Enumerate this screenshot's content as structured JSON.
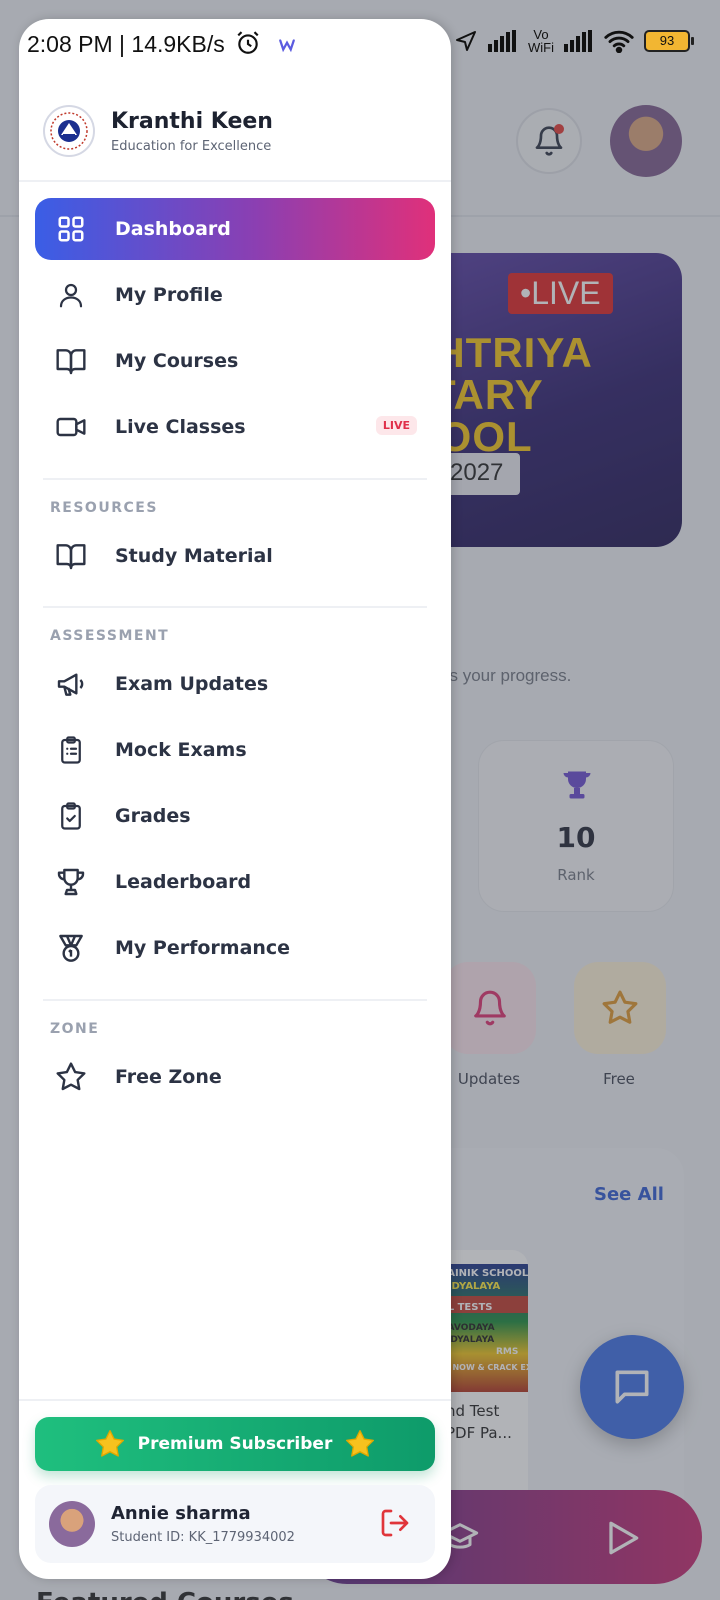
{
  "status_bar": {
    "time": "2:08 PM | 14.9KB/s",
    "vowifi_top": "Vo",
    "vowifi_bottom": "WiFi",
    "battery": "93"
  },
  "drawer": {
    "brand": {
      "name": "Kranthi Keen",
      "tagline": "Education for Excellence"
    },
    "main_items": [
      {
        "label": "Dashboard",
        "icon": "grid-icon",
        "active": true
      },
      {
        "label": "My Profile",
        "icon": "user-icon"
      },
      {
        "label": "My Courses",
        "icon": "book-open-icon"
      },
      {
        "label": "Live Classes",
        "icon": "video-icon",
        "badge": "LIVE"
      }
    ],
    "sections": [
      {
        "title": "RESOURCES",
        "items": [
          {
            "label": "Study Material",
            "icon": "book-open-icon"
          }
        ]
      },
      {
        "title": "ASSESSMENT",
        "items": [
          {
            "label": "Exam Updates",
            "icon": "megaphone-icon"
          },
          {
            "label": "Mock Exams",
            "icon": "clipboard-list-icon"
          },
          {
            "label": "Grades",
            "icon": "clipboard-check-icon"
          },
          {
            "label": "Leaderboard",
            "icon": "trophy-icon"
          },
          {
            "label": "My Performance",
            "icon": "medal-icon"
          }
        ]
      },
      {
        "title": "ZONE",
        "items": [
          {
            "label": "Free Zone",
            "icon": "star-icon"
          }
        ]
      }
    ],
    "premium_label": "Premium Subscriber",
    "user": {
      "name": "Annie sharma",
      "student_id": "Student ID: KK_1779934002"
    }
  },
  "background": {
    "banner": {
      "live": "•LIVE",
      "line1": "ASHTRIYA",
      "line2": "ILITARY",
      "line3": "CHOOL",
      "year": "2027"
    },
    "progress_text": "’s your progress.",
    "rank": {
      "value": "10",
      "label": "Rank"
    },
    "quick_links": [
      {
        "label": "Updates",
        "icon": "bell-icon",
        "color": "#e0306e"
      },
      {
        "label": "Free",
        "icon": "star-icon",
        "color": "#e0962a"
      }
    ],
    "courses": {
      "see_all": "See All",
      "card_title_1": "nd Test",
      "card_title_2": "PDF Pa...",
      "thumb_line1": "SAINIK SCHOOL",
      "thumb_line2": "VIDYALAYA",
      "thumb_line3": "AL TESTS",
      "thumb_line4": "NAVODAYA",
      "thumb_line5": "VIDYALAYA",
      "thumb_line6": "RMS",
      "thumb_line7": "IN NOW & CRACK EXA"
    },
    "featured_heading": "Featured Courses"
  }
}
